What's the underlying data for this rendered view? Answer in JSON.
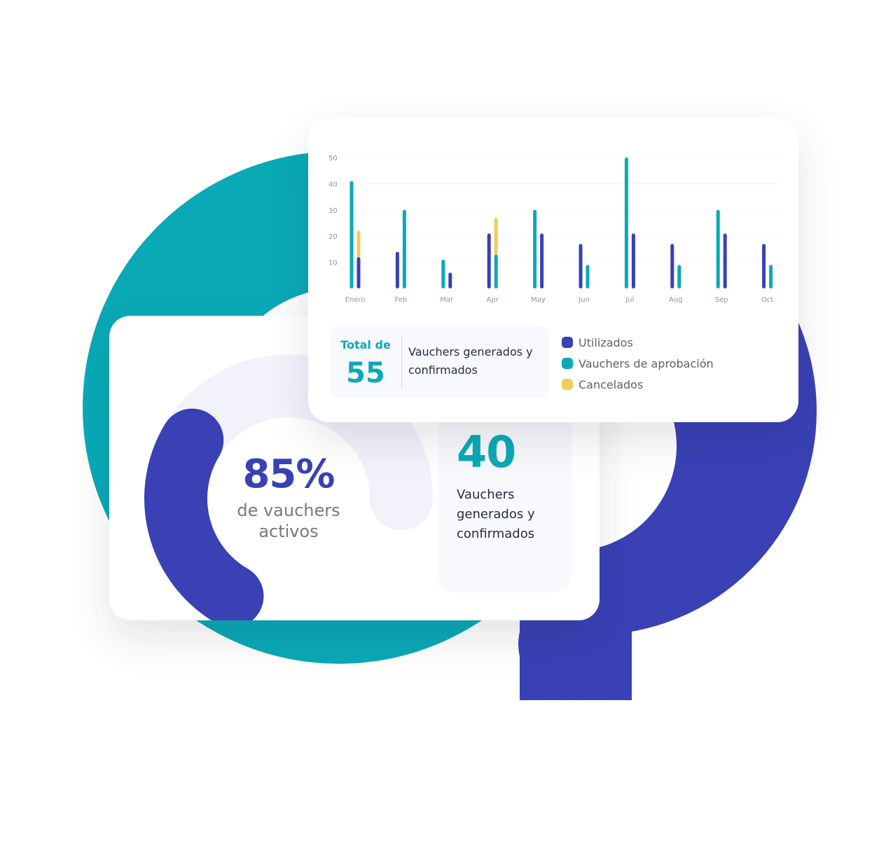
{
  "colors": {
    "teal": "#0aa9b6",
    "indigo": "#3941b5",
    "yellow": "#f0cd58",
    "track": "#f1f2fa"
  },
  "gauge": {
    "value_label": "85%",
    "caption": "de vauchers activos",
    "fraction": 0.85
  },
  "stat": {
    "value": "40",
    "label": "Vauchers generados y confirmados"
  },
  "summary": {
    "label": "Total de",
    "value": "55",
    "description": "Vauchers generados y confirmados"
  },
  "chart_data": {
    "type": "bar",
    "categories": [
      "Enero",
      "Feb",
      "Mar",
      "Apr",
      "May",
      "Jun",
      "Jul",
      "Aug",
      "Sep",
      "Oct"
    ],
    "series": [
      {
        "name": "Utilizados",
        "color": "#3941b5",
        "values": [
          12,
          14,
          6,
          21,
          21,
          17,
          21,
          17,
          21,
          17
        ]
      },
      {
        "name": "Vauchers de aprobación",
        "color": "#0aa9b6",
        "values": [
          41,
          30,
          11,
          13,
          30,
          9,
          50,
          9,
          30,
          9
        ]
      },
      {
        "name": "Cancelados",
        "color": "#f0cd58",
        "values": [
          10,
          0,
          0,
          14,
          0,
          0,
          0,
          0,
          0,
          0
        ]
      }
    ],
    "stacking": "Cancelados stacked on top of Utilizados (Enero) and Vauchers de aprobación (Apr)",
    "y_ticks": [
      10,
      20,
      30,
      40,
      50
    ],
    "ylim": [
      0,
      50
    ],
    "grid": true,
    "legend": "bottom-right"
  }
}
